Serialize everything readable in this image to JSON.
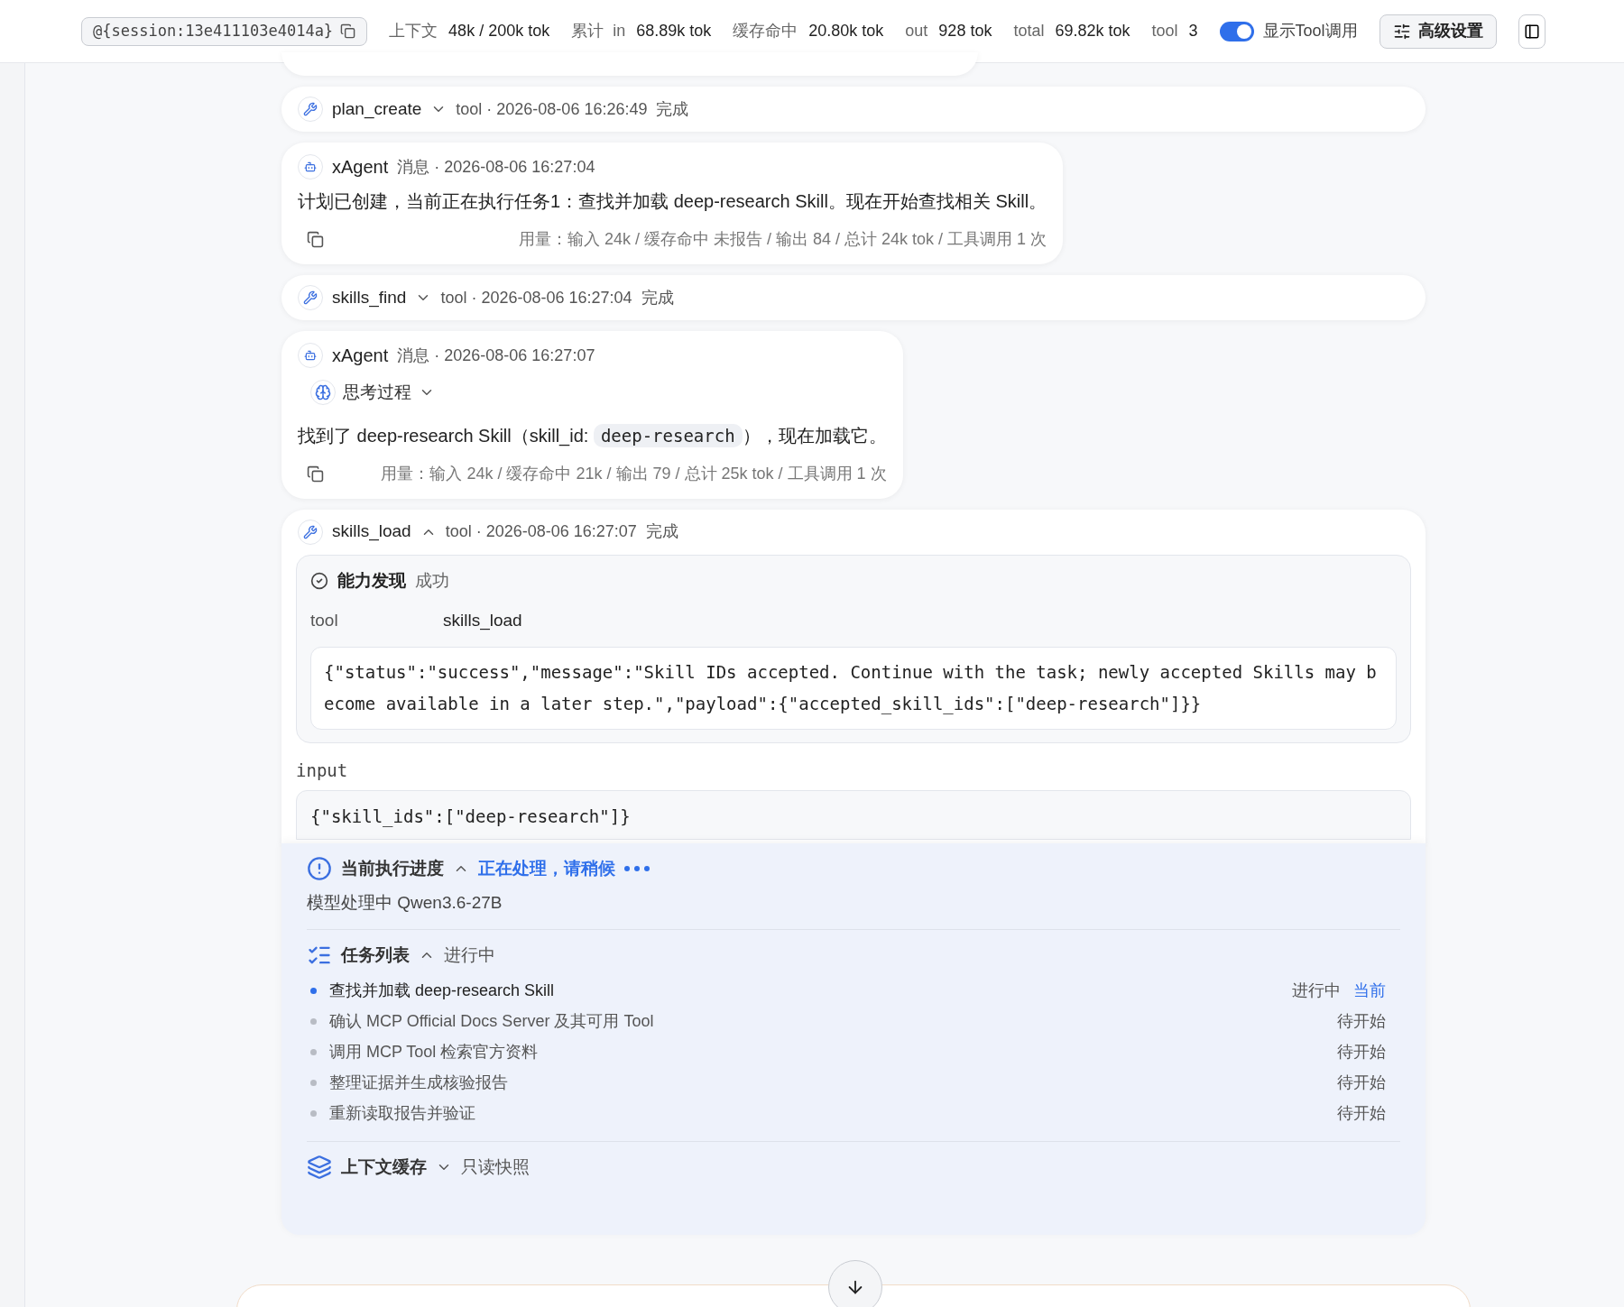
{
  "topbar": {
    "session": "@{session:13e411103e4014a}",
    "stats": [
      {
        "label": "上下文",
        "value": "48k / 200k tok"
      },
      {
        "label": "累计  in",
        "value": "68.89k tok"
      },
      {
        "label": "缓存命中",
        "value": "20.80k tok"
      },
      {
        "label": "out",
        "value": "928 tok"
      },
      {
        "label": "total",
        "value": "69.82k tok"
      },
      {
        "label": "tool",
        "value": "3"
      }
    ],
    "toggle": {
      "label": "显示Tool调用",
      "on": true
    },
    "advanced_button": "高级设置"
  },
  "timeline": [
    {
      "kind": "tool",
      "name": "plan_create",
      "expanded": false,
      "meta": "tool · 2026-08-06 16:26:49",
      "status": "完成"
    },
    {
      "kind": "message",
      "sender": "xAgent",
      "meta": "消息 · 2026-08-06 16:27:04",
      "segments": [
        {
          "kind": "text",
          "text": "计划已创建，当前正在执行任务1：查找并加载 deep-research Skill。现在开始查找相关 Skill。"
        }
      ],
      "usage": "用量：输入 24k / 缓存命中 未报告 / 输出 84 / 总计 24k tok / 工具调用 1 次"
    },
    {
      "kind": "tool",
      "name": "skills_find",
      "expanded": false,
      "meta": "tool · 2026-08-06 16:27:04",
      "status": "完成"
    },
    {
      "kind": "message",
      "sender": "xAgent",
      "meta": "消息 · 2026-08-06 16:27:07",
      "thinking": {
        "label": "思考过程",
        "expanded": false
      },
      "segments": [
        {
          "kind": "text",
          "text": "找到了 deep-research Skill（skill_id: "
        },
        {
          "kind": "code",
          "text": "deep-research"
        },
        {
          "kind": "text",
          "text": "），现在加载它。"
        }
      ],
      "usage": "用量：输入 24k / 缓存命中 21k / 输出 79 / 总计 25k tok / 工具调用 1 次"
    },
    {
      "kind": "tool",
      "name": "skills_load",
      "expanded": true,
      "meta": "tool · 2026-08-06 16:27:07",
      "status": "完成",
      "result": {
        "title": "能力发现",
        "status": "成功",
        "fields": [
          {
            "label": "tool",
            "value": "skills_load"
          }
        ],
        "output": "{\"status\":\"success\",\"message\":\"Skill IDs accepted. Continue with the task; newly accepted Skills may become available in a later step.\",\"payload\":{\"accepted_skill_ids\":[\"deep-research\"]}}"
      },
      "input_label": "input",
      "input": "{\"skill_ids\":[\"deep-research\"]}"
    }
  ],
  "progress": {
    "title": "当前执行进度",
    "expanded": true,
    "status": "正在处理，请稍候",
    "model": "模型处理中 Qwen3.6-27B",
    "tasks": {
      "title": "任务列表",
      "expanded": true,
      "status": "进行中",
      "items": [
        {
          "text": "查找并加载 deep-research Skill",
          "status": "进行中",
          "selected": true,
          "current_label": "当前"
        },
        {
          "text": "确认 MCP Official Docs Server 及其可用 Tool",
          "status": "待开始",
          "selected": false
        },
        {
          "text": "调用 MCP Tool 检索官方资料",
          "status": "待开始",
          "selected": false
        },
        {
          "text": "整理证据并生成核验报告",
          "status": "待开始",
          "selected": false
        },
        {
          "text": "重新读取报告并验证",
          "status": "待开始",
          "selected": false
        }
      ]
    },
    "cache": {
      "title": "上下文缓存",
      "expanded": false,
      "note": "只读快照"
    }
  }
}
